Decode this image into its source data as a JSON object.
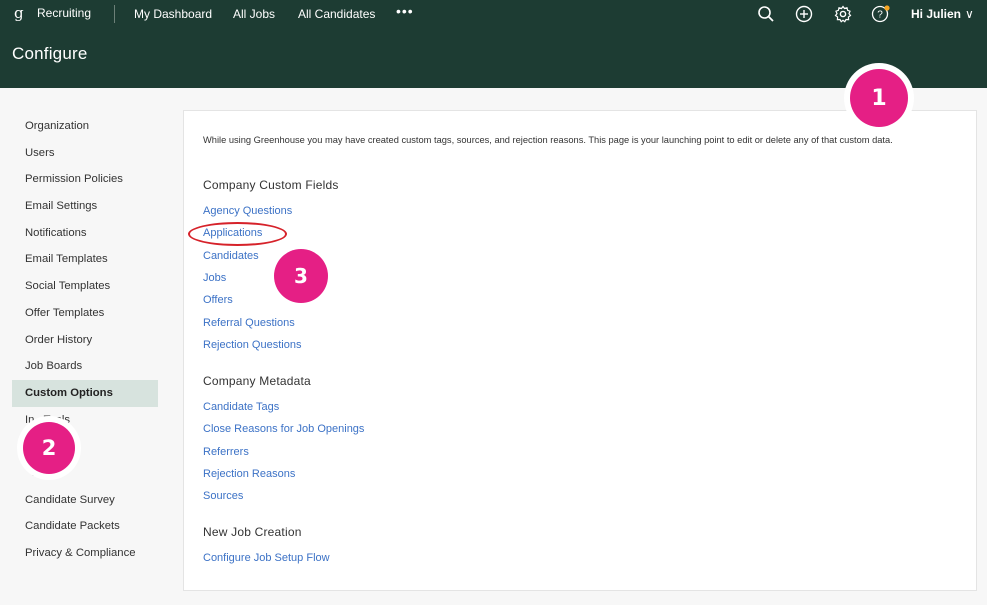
{
  "topbar": {
    "logo": "g",
    "app_name": "Recruiting",
    "nav": [
      "My Dashboard",
      "All Jobs",
      "All Candidates"
    ],
    "more": "•••",
    "user": "Hi Julien",
    "user_chevron": "∨",
    "help_glyph": "?",
    "icons": [
      "search-icon",
      "add-icon",
      "gear-icon",
      "help-icon"
    ]
  },
  "header": {
    "title": "Configure"
  },
  "sidebar": {
    "items": [
      "Organization",
      "Users",
      "Permission Policies",
      "Email Settings",
      "Notifications",
      "Email Templates",
      "Social Templates",
      "Offer Templates",
      "Order History",
      "Job Boards",
      "Custom Options",
      "In   Tools",
      "",
      "  og",
      "Candidate Survey",
      "Candidate Packets",
      "Privacy & Compliance"
    ],
    "active": "Custom Options"
  },
  "main": {
    "intro": "While using Greenhouse you may have created custom tags, sources, and rejection reasons. This page is your launching point to edit or delete any of that custom data.",
    "sections": [
      {
        "title": "Company Custom Fields",
        "links": [
          "Agency Questions",
          "Applications",
          "Candidates",
          "Jobs",
          "Offers",
          "Referral Questions",
          "Rejection Questions"
        ]
      },
      {
        "title": "Company Metadata",
        "links": [
          "Candidate Tags",
          "Close Reasons for Job Openings",
          "Referrers",
          "Rejection Reasons",
          "Sources"
        ]
      },
      {
        "title": "New Job Creation",
        "links": [
          "Configure Job Setup Flow"
        ]
      }
    ]
  },
  "annotations": {
    "badge1": "1",
    "badge2": "2",
    "badge3": "3"
  },
  "colors": {
    "header_bg": "#1d3c33",
    "link": "#3c72c6",
    "active_bg": "#d7e3de",
    "badge": "#e51f85",
    "highlight": "#d6222a"
  }
}
